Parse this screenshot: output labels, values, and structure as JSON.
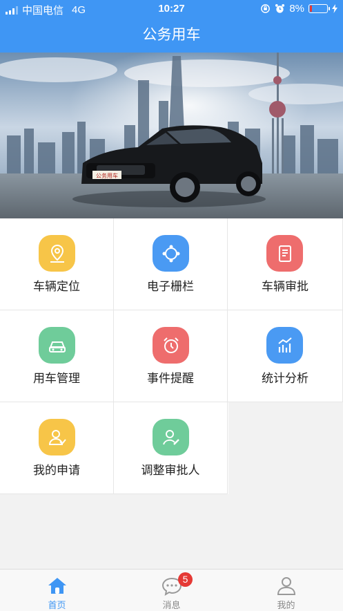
{
  "status": {
    "carrier": "中国电信",
    "network": "4G",
    "time": "10:27",
    "battery": "8%"
  },
  "header": {
    "title": "公务用车"
  },
  "banner": {
    "plate": "公务用车"
  },
  "menu": {
    "items": [
      {
        "label": "车辆定位",
        "icon": "location-pin-icon",
        "color": "#f7c548"
      },
      {
        "label": "电子栅栏",
        "icon": "geofence-icon",
        "color": "#4a9af3"
      },
      {
        "label": "车辆审批",
        "icon": "document-icon",
        "color": "#ee6d6d"
      },
      {
        "label": "用车管理",
        "icon": "car-icon",
        "color": "#6fcc9a"
      },
      {
        "label": "事件提醒",
        "icon": "alarm-clock-icon",
        "color": "#ee6d6d"
      },
      {
        "label": "统计分析",
        "icon": "bar-chart-icon",
        "color": "#4a9af3"
      },
      {
        "label": "我的申请",
        "icon": "user-check-icon",
        "color": "#f7c548"
      },
      {
        "label": "调整审批人",
        "icon": "user-edit-icon",
        "color": "#6fcc9a"
      }
    ]
  },
  "tabbar": {
    "items": [
      {
        "label": "首页",
        "icon": "home-icon",
        "active": true
      },
      {
        "label": "消息",
        "icon": "message-icon",
        "badge": "5"
      },
      {
        "label": "我的",
        "icon": "profile-icon"
      }
    ]
  },
  "colors": {
    "primary": "#3f96f4",
    "badge": "#e53935"
  }
}
